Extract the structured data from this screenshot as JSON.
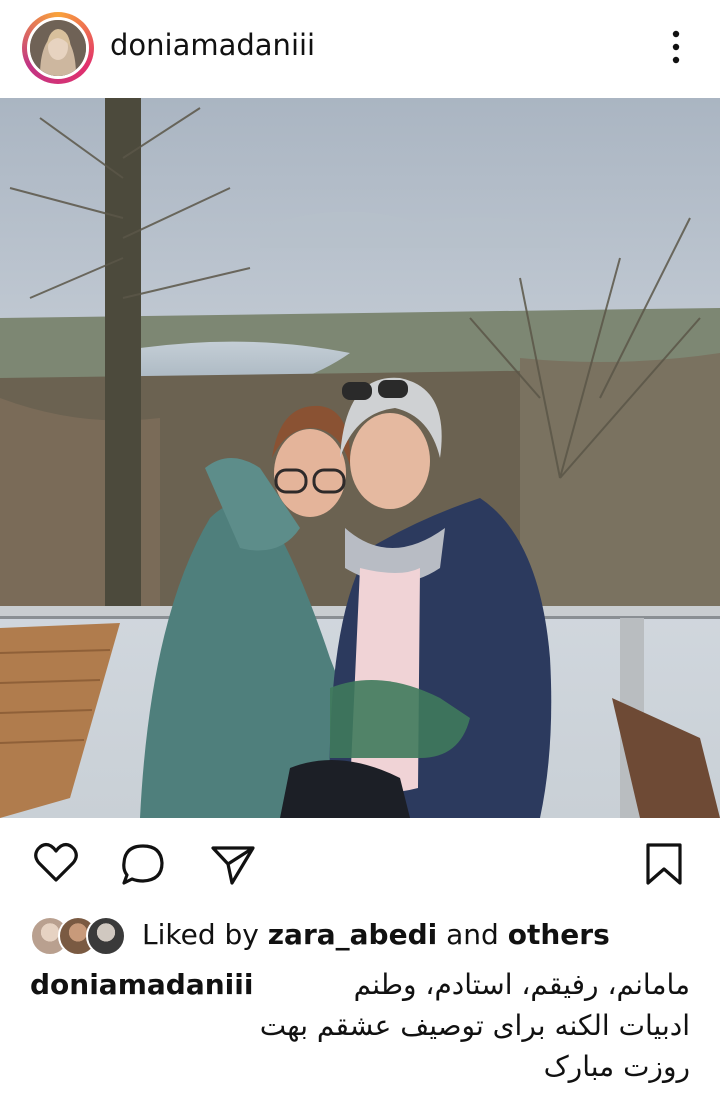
{
  "post": {
    "username": "doniamadaniii",
    "photo_alt": "",
    "likes": {
      "prefix": "Liked by",
      "user": "zara_abedi",
      "middle": "and",
      "suffix": "others"
    },
    "caption": {
      "username": "doniamadaniii",
      "lines": [
        "مامانم، رفیقم، استادم، وطنم",
        "ادبیات الکنه برای توصیف عشقم بهت",
        "روزت مبارک"
      ]
    }
  },
  "icons": {
    "more": "more-vertical-icon",
    "like": "heart-icon",
    "comment": "comment-icon",
    "share": "send-icon",
    "save": "bookmark-icon"
  },
  "colors": {
    "text": "#111111",
    "ring_start": "#f9a33a",
    "ring_mid": "#e1306c"
  }
}
